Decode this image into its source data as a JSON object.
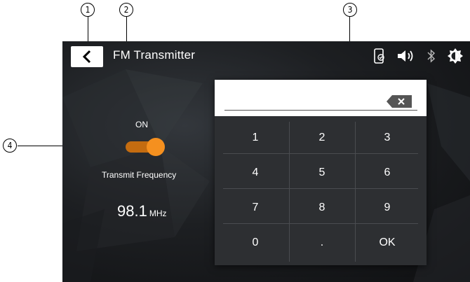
{
  "callouts": [
    "1",
    "2",
    "3",
    "4"
  ],
  "header": {
    "back_icon": "chevron-left-icon",
    "title": "FM Transmitter",
    "status_icons": [
      "phone-link-icon",
      "volume-icon",
      "bluetooth-icon",
      "brightness-icon"
    ]
  },
  "transmitter": {
    "toggle_label": "ON",
    "toggle_state": true,
    "frequency_label": "Transmit Frequency",
    "frequency_value": "98.1",
    "frequency_unit": "MHz"
  },
  "keypad": {
    "entry_value": "",
    "backspace_icon": "backspace-icon",
    "keys": [
      "1",
      "2",
      "3",
      "4",
      "5",
      "6",
      "7",
      "8",
      "9",
      "0",
      ".",
      "OK"
    ]
  },
  "colors": {
    "accent": "#f5901f",
    "accent_dark": "#c46c10",
    "screen_bg": "#1d1f22",
    "keypad_bg": "#2d2f32"
  }
}
